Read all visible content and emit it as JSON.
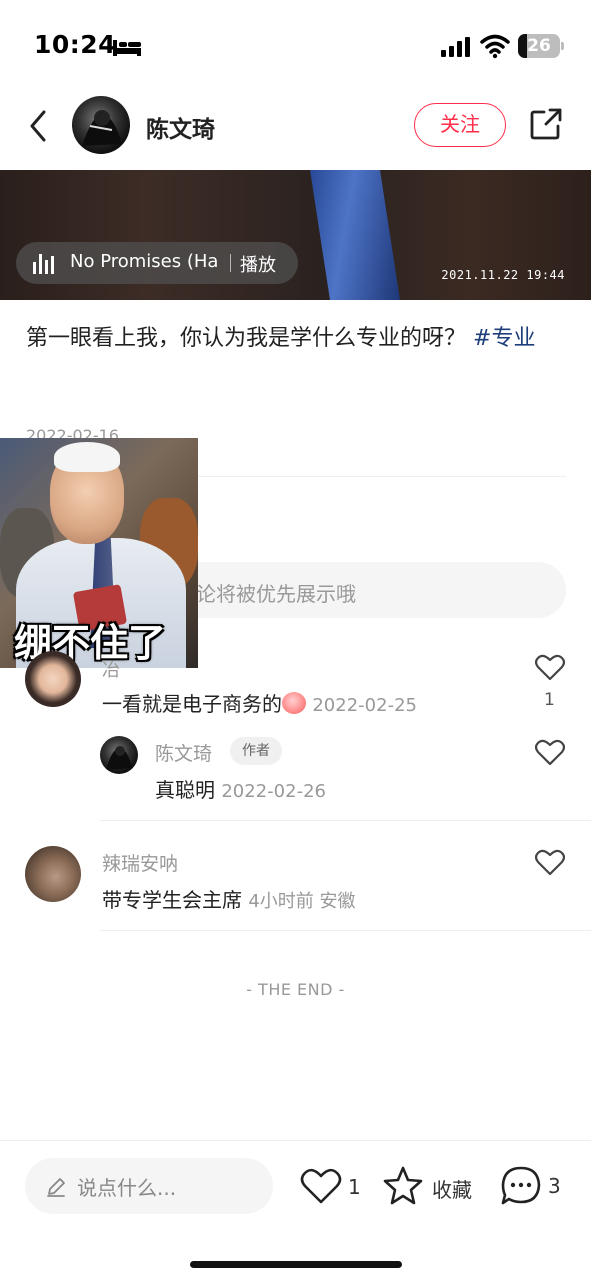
{
  "status_bar": {
    "time": "10:24",
    "battery_level": "26",
    "icons": [
      "bed-icon",
      "signal-icon",
      "wifi-icon",
      "battery-icon"
    ]
  },
  "header": {
    "author_name": "陈文琦",
    "follow_label": "关注",
    "icons": [
      "back-icon",
      "share-icon"
    ]
  },
  "media": {
    "music_title": "No Promises (Ha",
    "music_action": "播放",
    "timestamp": "2021.11.22 19:44"
  },
  "post": {
    "text": "第一眼看上我，你认为我是学什么专业的呀？",
    "hashtag": "#专业",
    "date": "2022-02-16"
  },
  "sticker": {
    "caption": "绷不住了"
  },
  "comment_box": {
    "placeholder": "论将被优先展示哦"
  },
  "comments": [
    {
      "name": "冶",
      "text": "一看就是电子商务的",
      "date": "2022-02-25",
      "likes": "1",
      "replies": [
        {
          "name": "陈文琦",
          "badge": "作者",
          "text": "真聪明",
          "date": "2022-02-26"
        }
      ]
    },
    {
      "name": "辣瑞安呐",
      "text": "带专学生会主席",
      "date": "4小时前 安徽"
    }
  ],
  "end_text": "- THE END -",
  "bottom_bar": {
    "input_placeholder": "说点什么...",
    "like_count": "1",
    "collect_label": "收藏",
    "comment_count": "3"
  },
  "colors": {
    "accent": "#ff2d4a",
    "hashtag": "#1e3d7b",
    "muted_text": "#999999"
  }
}
